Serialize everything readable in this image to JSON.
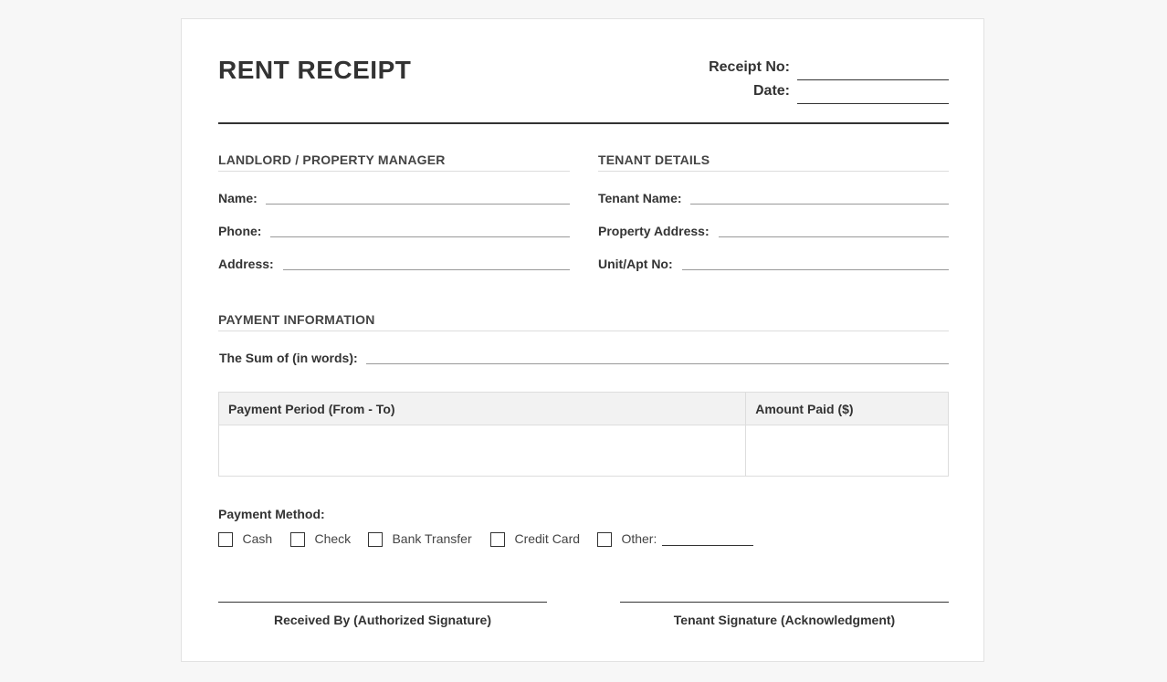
{
  "receipt": {
    "title": "RENT RECEIPT",
    "receipt_no_label": "Receipt No:",
    "receipt_no_value": "",
    "date_label": "Date:",
    "date_value": ""
  },
  "landlord": {
    "heading": "LANDLORD / PROPERTY MANAGER",
    "name_label": "Name:",
    "phone_label": "Phone:",
    "address_label": "Address:"
  },
  "tenant": {
    "heading": "TENANT DETAILS",
    "name_label": "Tenant Name:",
    "property_label": "Property Address:",
    "unit_label": "Unit/Apt No:"
  },
  "payment": {
    "heading": "PAYMENT INFORMATION",
    "sum_label": "The Sum of (in words):",
    "table": {
      "headers": [
        "Payment Period (From - To)",
        "Amount Paid ($)"
      ],
      "rows": [
        [
          "",
          ""
        ]
      ]
    },
    "method_label": "Payment Method:",
    "methods": [
      "Cash",
      "Check",
      "Bank Transfer",
      "Credit Card",
      "Other:"
    ]
  },
  "signatures": {
    "received_by": "Received By (Authorized Signature)",
    "tenant": "Tenant Signature (Acknowledgment)"
  }
}
